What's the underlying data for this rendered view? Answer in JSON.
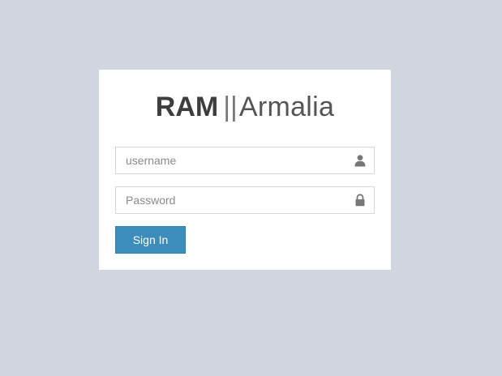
{
  "brand": {
    "name_bold": "RAM",
    "separator": "||",
    "name_light": "Armalia"
  },
  "form": {
    "username": {
      "placeholder": "username",
      "value": "",
      "icon": "user-icon"
    },
    "password": {
      "placeholder": "Password",
      "value": "",
      "icon": "lock-icon"
    },
    "submit_label": "Sign In"
  },
  "colors": {
    "page_background": "#d2d6de",
    "card_background": "#ffffff",
    "accent": "#3c8dbc",
    "input_border": "#d2d6de",
    "icon": "#777777"
  }
}
